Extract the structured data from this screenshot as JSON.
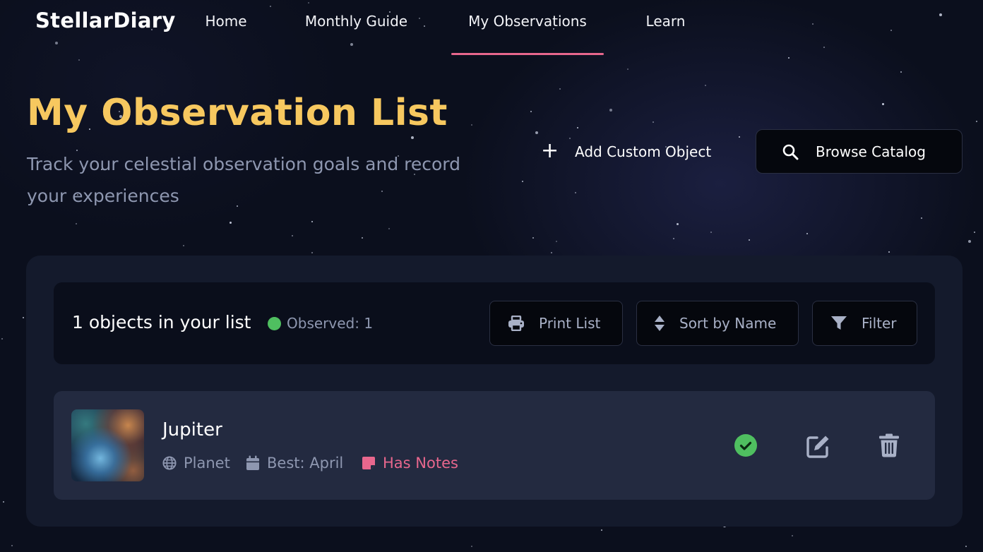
{
  "nav": {
    "logo": "StellarDiary",
    "links": [
      {
        "label": "Home"
      },
      {
        "label": "Monthly Guide"
      },
      {
        "label": "My Observations",
        "active": true
      },
      {
        "label": "Learn"
      }
    ],
    "active_color": "#e8678d"
  },
  "header": {
    "title": "My Observation List",
    "subtitle": "Track your celestial observation goals and record your experiences",
    "add_button": "Add Custom Object",
    "browse_button": "Browse Catalog",
    "title_color": "#f7c85f"
  },
  "toolbar": {
    "count_text": "1 objects in your list",
    "observed_text": "Observed: 1",
    "print_label": "Print List",
    "sort_label": "Sort by Name",
    "filter_label": "Filter"
  },
  "items": [
    {
      "name": "Jupiter",
      "type": "Planet",
      "best": "Best: April",
      "notes": "Has Notes",
      "observed": true,
      "icons": [
        "globe-icon",
        "calendar-icon",
        "sticky-note-icon",
        "check-circle-icon",
        "edit-icon",
        "trash-icon"
      ]
    }
  ],
  "colors": {
    "background": "#0b0f1d",
    "panel": "#141a2c",
    "row": "#232a40",
    "observed_green": "#4fbf60",
    "notes_pink": "#e8678d"
  }
}
